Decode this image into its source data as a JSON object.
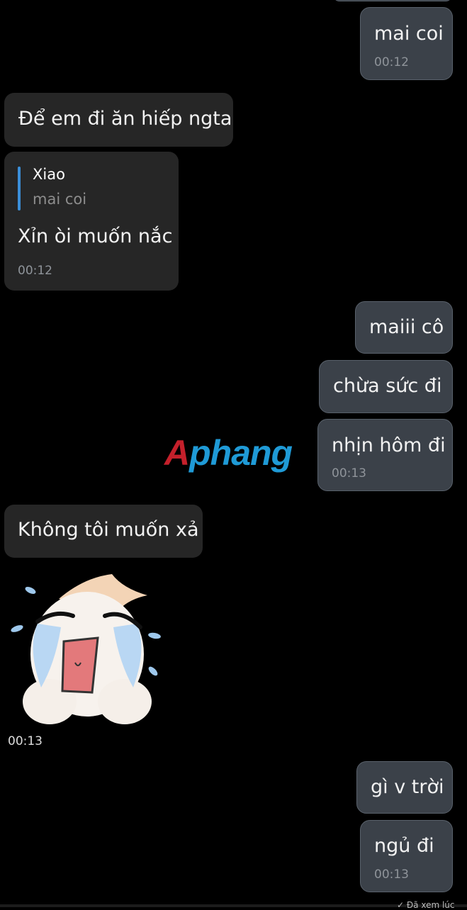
{
  "messages": [
    {
      "text": "mai coi",
      "time": "00:12"
    },
    {
      "text": "Để em đi ăn hiếp ngta"
    },
    {
      "reply_name": "Xiao",
      "reply_text": "mai coi",
      "text": "Xỉn òi muốn nắc",
      "time": "00:12"
    },
    {
      "text": "maiii cô"
    },
    {
      "text": "chừa sức đi"
    },
    {
      "text": "nhịn hôm đi",
      "time": "00:13"
    },
    {
      "text": "Không tôi muốn xả"
    },
    {
      "text": "gì v trời"
    },
    {
      "text": "ngủ đi",
      "time": "00:13"
    }
  ],
  "sticker": {
    "time": "00:13",
    "icon": "crying-sticker-icon"
  },
  "watermark": {
    "first": "A",
    "rest": "phang"
  },
  "partial_bottom_text": "✓ Đã xem lúc",
  "colors": {
    "background": "#000000",
    "outgoing_bubble": "#3b4149",
    "incoming_bubble": "#262626",
    "reply_accent": "#3b8fd9"
  }
}
